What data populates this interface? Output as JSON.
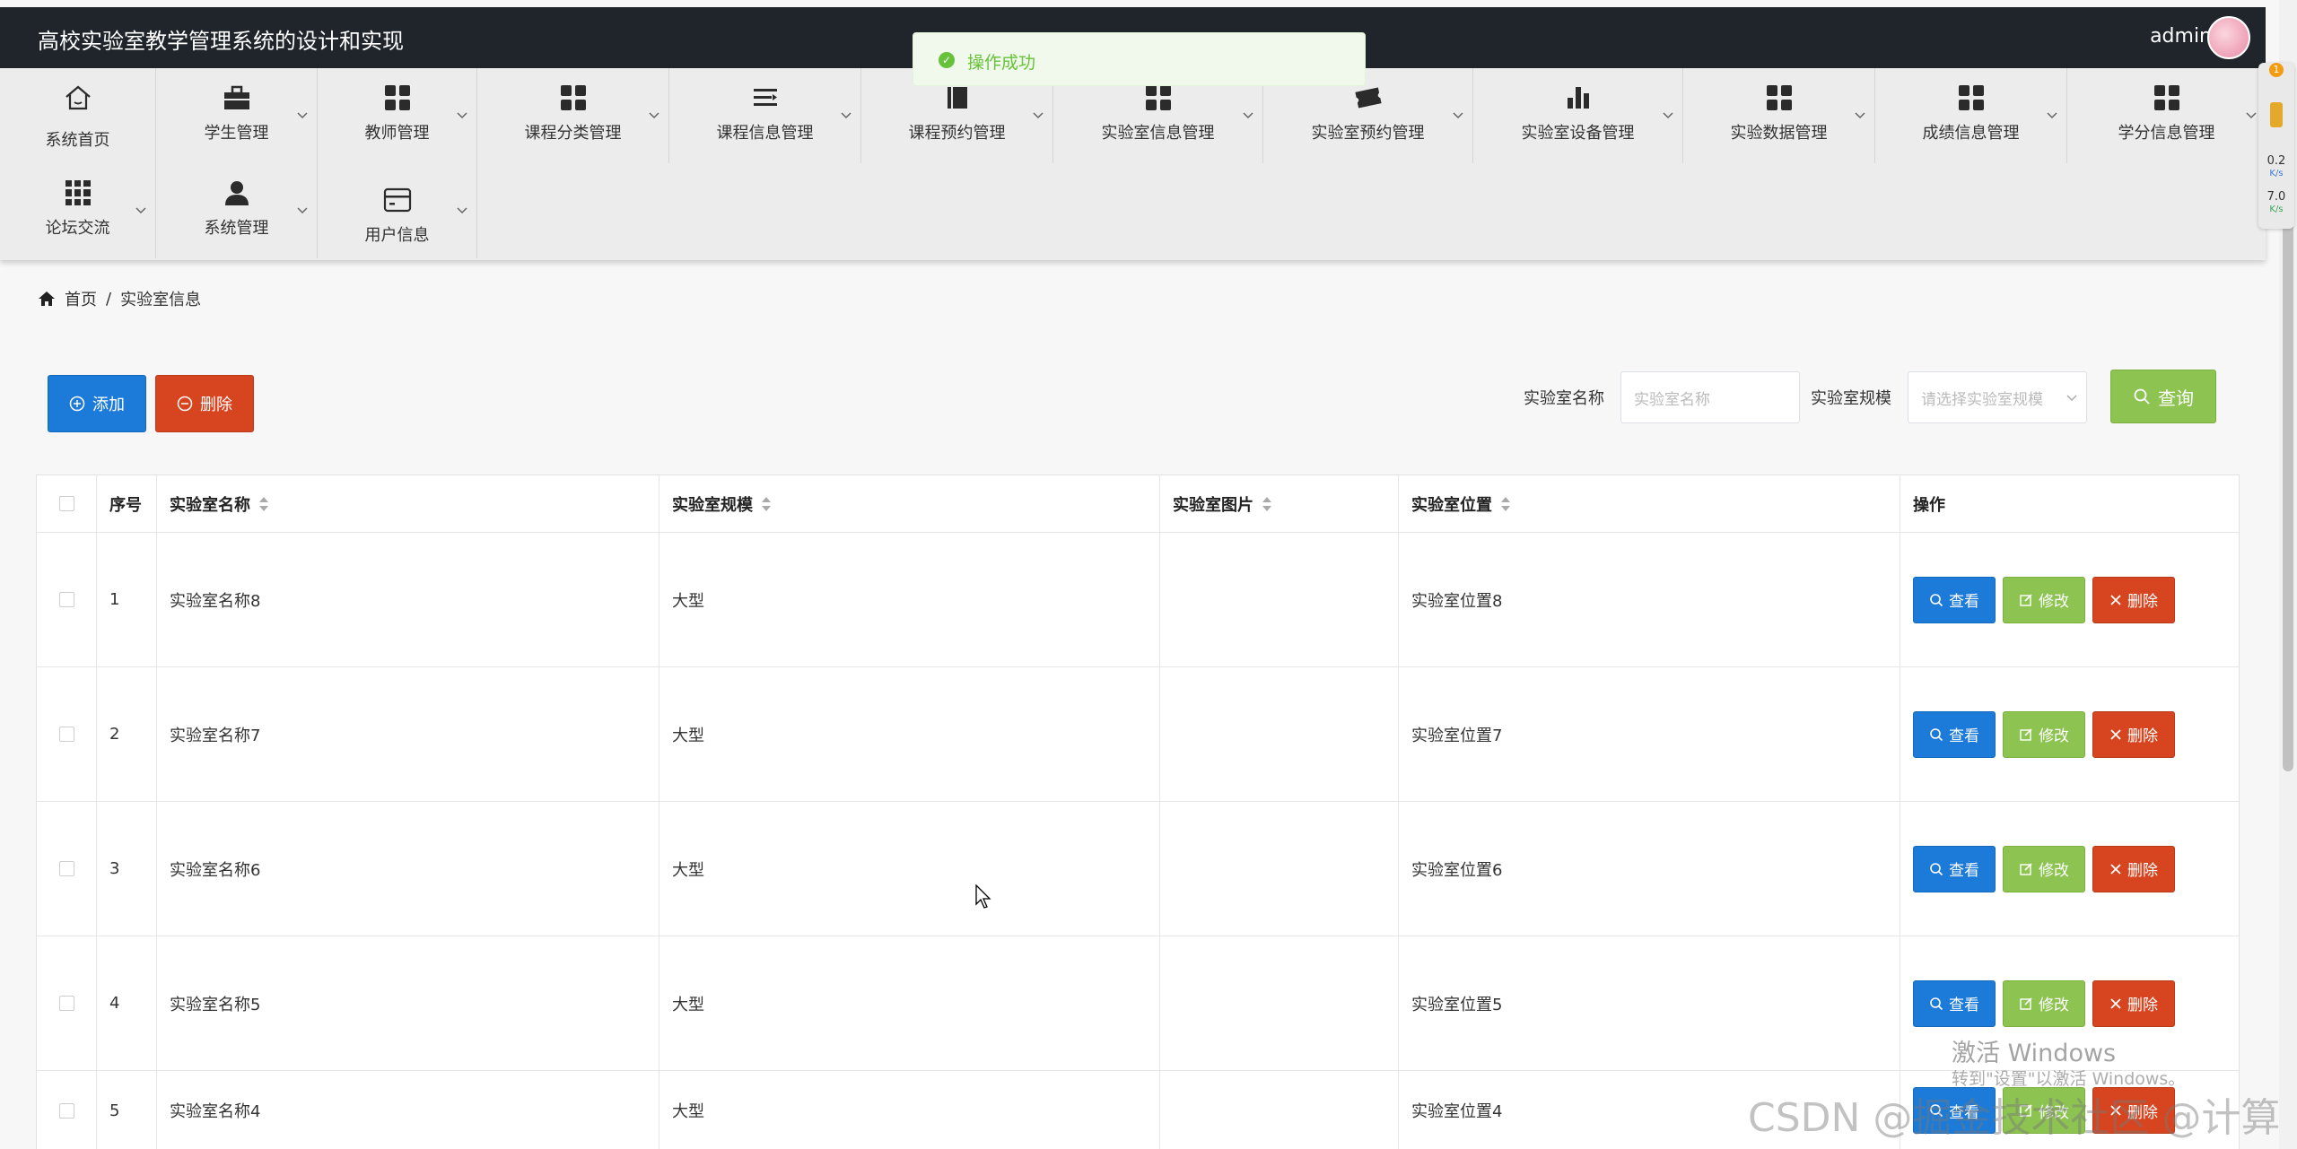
{
  "header": {
    "title": "高校实验室教学管理系统的设计和实现",
    "user": "admin"
  },
  "toast": {
    "message": "操作成功"
  },
  "nav": {
    "items": [
      {
        "label": "系统首页",
        "icon": "home-icon"
      },
      {
        "label": "学生管理",
        "icon": "briefcase-icon"
      },
      {
        "label": "教师管理",
        "icon": "grid-icon"
      },
      {
        "label": "课程分类管理",
        "icon": "grid-icon"
      },
      {
        "label": "课程信息管理",
        "icon": "list-icon"
      },
      {
        "label": "课程预约管理",
        "icon": "book-icon"
      },
      {
        "label": "实验室信息管理",
        "icon": "grid-icon"
      },
      {
        "label": "实验室预约管理",
        "icon": "ticket-icon"
      },
      {
        "label": "实验室设备管理",
        "icon": "bar-chart-icon"
      },
      {
        "label": "实验数据管理",
        "icon": "grid-icon"
      },
      {
        "label": "成绩信息管理",
        "icon": "grid-icon"
      },
      {
        "label": "学分信息管理",
        "icon": "grid-icon"
      },
      {
        "label": "论坛交流",
        "icon": "apps-icon"
      },
      {
        "label": "系统管理",
        "icon": "user-icon"
      },
      {
        "label": "用户信息",
        "icon": "card-icon"
      }
    ]
  },
  "breadcrumb": {
    "home": "首页",
    "separator": "/",
    "current": "实验室信息"
  },
  "actions": {
    "add_label": "添加",
    "delete_label": "删除"
  },
  "search": {
    "name_label": "实验室名称",
    "name_placeholder": "实验室名称",
    "scale_label": "实验室规模",
    "scale_placeholder": "请选择实验室规模",
    "query_label": "查询"
  },
  "table": {
    "headers": [
      "序号",
      "实验室名称",
      "实验室规模",
      "实验室图片",
      "实验室位置",
      "操作"
    ],
    "rows": [
      {
        "index": "1",
        "name": "实验室名称8",
        "scale": "大型",
        "image": "",
        "location": "实验室位置8"
      },
      {
        "index": "2",
        "name": "实验室名称7",
        "scale": "大型",
        "image": "",
        "location": "实验室位置7"
      },
      {
        "index": "3",
        "name": "实验室名称6",
        "scale": "大型",
        "image": "",
        "location": "实验室位置6"
      },
      {
        "index": "4",
        "name": "实验室名称5",
        "scale": "大型",
        "image": "",
        "location": "实验室位置5"
      },
      {
        "index": "5",
        "name": "实验室名称4",
        "scale": "大型",
        "image": "",
        "location": "实验室位置4"
      }
    ],
    "row_actions": {
      "view": "查看",
      "edit": "修改",
      "delete": "删除"
    }
  },
  "widget": {
    "badge": "1",
    "upload": "0.2",
    "upload_unit": "K/s",
    "download": "7.0",
    "download_unit": "K/s"
  },
  "watermark": {
    "activate_title": "激活 Windows",
    "activate_sub": "转到\"设置\"以激活 Windows。",
    "csdn": "CSDN @掘金技术社区 @计算机毕设小月哥"
  }
}
